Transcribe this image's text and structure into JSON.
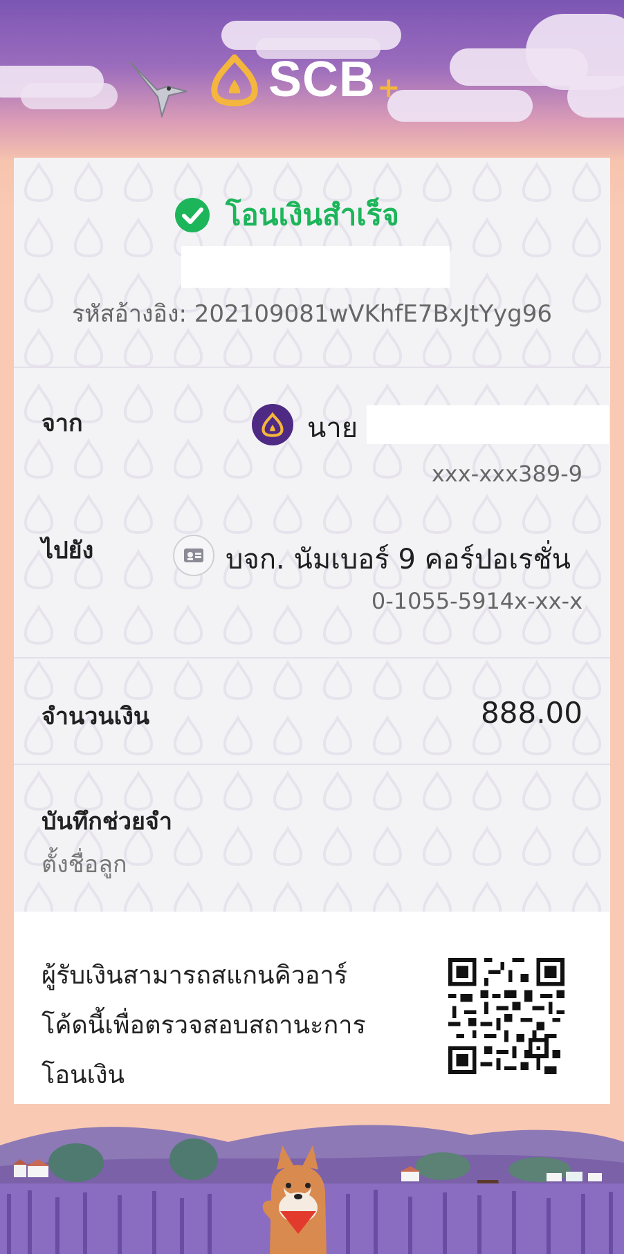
{
  "brand": {
    "name": "SCB",
    "plus": "+"
  },
  "status": {
    "title": "โอนเงินสำเร็จ"
  },
  "reference": {
    "label": "รหัสอ้างอิง:",
    "value": "202109081wVKhfE7BxJtYyg96"
  },
  "from": {
    "label": "จาก",
    "name": "นาย",
    "account": "xxx-xxx389-9"
  },
  "to": {
    "label": "ไปยัง",
    "name": "บจก. นัมเบอร์ 9 คอร์ปอเรชั่น",
    "account": "0-1055-5914x-xx-x"
  },
  "amount": {
    "label": "จำนวนเงิน",
    "value": "888.00"
  },
  "memo": {
    "label": "บันทึกช่วยจำ",
    "value": "ตั้งชื่อลูก"
  },
  "qr": {
    "text_line1": "ผู้รับเงินสามารถสแกนคิวอาร์",
    "text_line2": "โค้ดนี้เพื่อตรวจสอบสถานะการ",
    "text_line3": "โอนเงิน"
  },
  "colors": {
    "success": "#1db55a",
    "brand_purple": "#4e2a84",
    "brand_gold": "#f4b63c"
  }
}
